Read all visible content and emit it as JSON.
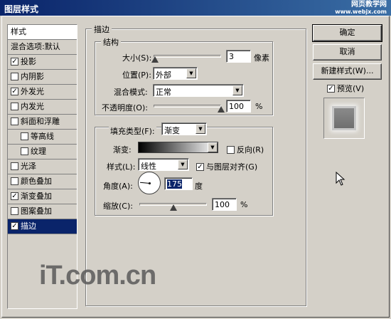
{
  "window": {
    "title": "图层样式"
  },
  "watermark_top": {
    "line1": "网页教学网",
    "line2": "www.webjx.com"
  },
  "sidebar": {
    "header": "样式",
    "items": [
      {
        "label": "混合选项:默认",
        "checkbox": false,
        "checked": false,
        "indent": false,
        "selected": false
      },
      {
        "label": "投影",
        "checkbox": true,
        "checked": true,
        "indent": false,
        "selected": false
      },
      {
        "label": "内阴影",
        "checkbox": true,
        "checked": false,
        "indent": false,
        "selected": false
      },
      {
        "label": "外发光",
        "checkbox": true,
        "checked": true,
        "indent": false,
        "selected": false
      },
      {
        "label": "内发光",
        "checkbox": true,
        "checked": false,
        "indent": false,
        "selected": false
      },
      {
        "label": "斜面和浮雕",
        "checkbox": true,
        "checked": false,
        "indent": false,
        "selected": false
      },
      {
        "label": "等高线",
        "checkbox": true,
        "checked": false,
        "indent": true,
        "selected": false
      },
      {
        "label": "纹理",
        "checkbox": true,
        "checked": false,
        "indent": true,
        "selected": false
      },
      {
        "label": "光泽",
        "checkbox": true,
        "checked": false,
        "indent": false,
        "selected": false
      },
      {
        "label": "颜色叠加",
        "checkbox": true,
        "checked": false,
        "indent": false,
        "selected": false
      },
      {
        "label": "渐变叠加",
        "checkbox": true,
        "checked": true,
        "indent": false,
        "selected": false
      },
      {
        "label": "图案叠加",
        "checkbox": true,
        "checked": false,
        "indent": false,
        "selected": false
      },
      {
        "label": "描边",
        "checkbox": true,
        "checked": true,
        "indent": false,
        "selected": true
      }
    ]
  },
  "stroke": {
    "group_title": "描边",
    "structure": {
      "title": "结构",
      "size_label": "大小(S):",
      "size_value": "3",
      "size_unit": "像素",
      "size_level": 0.02,
      "position_label": "位置(P):",
      "position_value": "外部",
      "blend_label": "混合模式:",
      "blend_value": "正常",
      "opacity_label": "不透明度(O):",
      "opacity_value": "100",
      "opacity_unit": "%",
      "opacity_level": 1.0
    },
    "fill": {
      "fill_type_label": "填充类型(F):",
      "fill_type_value": "渐变",
      "gradient_label": "渐变:",
      "reverse_label": "反向(R)",
      "reverse_checked": false,
      "style_label": "样式(L):",
      "style_value": "线性",
      "align_label": "与图层对齐(G)",
      "align_checked": true,
      "angle_label": "角度(A):",
      "angle_value": "175",
      "angle_unit": "度",
      "scale_label": "缩放(C):",
      "scale_value": "100",
      "scale_unit": "%",
      "scale_level": 0.5
    }
  },
  "buttons": {
    "ok": "确定",
    "cancel": "取消",
    "new_style": "新建样式(W)...",
    "preview_label": "预览(V)",
    "preview_checked": true
  },
  "watermark_bottom": "iT.com.cn"
}
